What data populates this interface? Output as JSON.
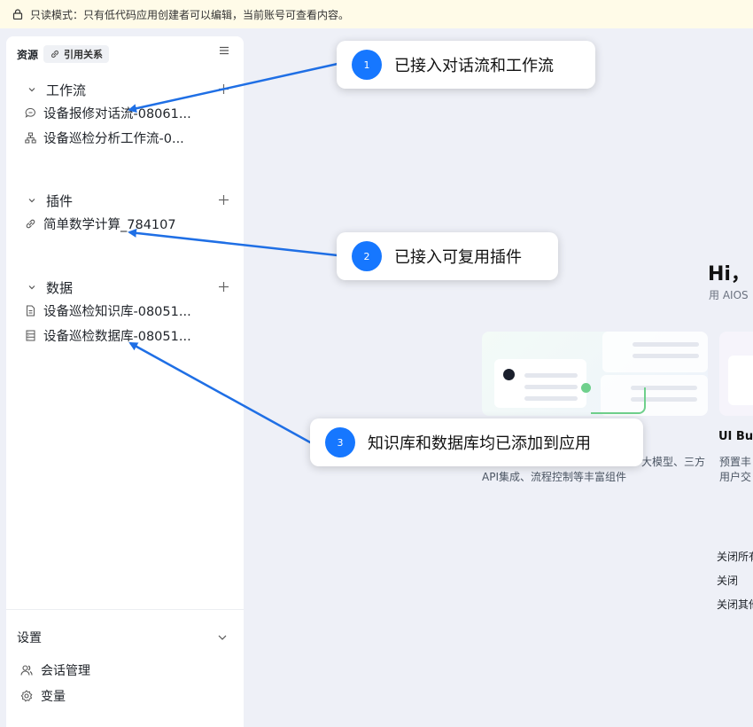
{
  "banner": {
    "text": "只读模式：只有低代码应用创建者可以编辑，当前账号可查看内容。"
  },
  "sidebar": {
    "title": "资源",
    "ref_chip": "引用关系",
    "sections": [
      {
        "label": "工作流",
        "items": [
          {
            "icon": "chat-bubble-icon",
            "label": "设备报修对话流-08061..."
          },
          {
            "icon": "workflow-tree-icon",
            "label": "设备巡检分析工作流-0..."
          }
        ]
      },
      {
        "label": "插件",
        "items": [
          {
            "icon": "plugin-link-icon",
            "label": "简单数学计算_784107"
          }
        ]
      },
      {
        "label": "数据",
        "items": [
          {
            "icon": "document-icon",
            "label": "设备巡检知识库-08051..."
          },
          {
            "icon": "database-icon",
            "label": "设备巡检数据库-08051..."
          }
        ]
      }
    ],
    "settings": {
      "label": "设置",
      "items": [
        {
          "icon": "users-icon",
          "label": "会话管理"
        },
        {
          "icon": "gear-icon",
          "label": "变量"
        }
      ]
    }
  },
  "main": {
    "greeting": "Hi，",
    "subtitle": "用 AIOS",
    "card1_desc_line1": "大模型、三方",
    "card1_desc_line2": "API集成、流程控制等丰富组件",
    "card2_title": "UI Bui",
    "card2_desc_line1": "预置丰",
    "card2_desc_line2": "用户交",
    "context_menu": [
      "关闭所有",
      "关闭",
      "关闭其他"
    ]
  },
  "callouts": [
    {
      "number": "1",
      "text": "已接入对话流和工作流"
    },
    {
      "number": "2",
      "text": "已接入可复用插件"
    },
    {
      "number": "3",
      "text": "知识库和数据库均已添加到应用"
    }
  ],
  "colors": {
    "accent": "#1677ff",
    "banner_bg": "#fffbe8",
    "main_bg": "#eef0f7"
  }
}
